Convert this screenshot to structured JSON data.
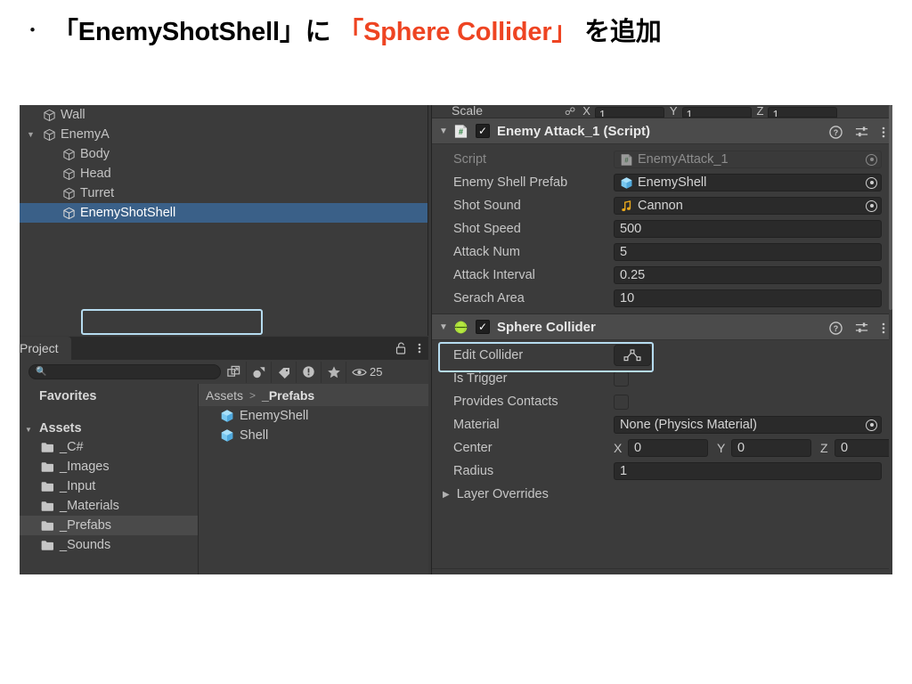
{
  "slide": {
    "bullet": "・",
    "title_main_1": "「EnemyShotShell」に ",
    "title_accent": "「Sphere Collider」",
    "title_main_2": " を追加",
    "accent_color": "#ee4422"
  },
  "hierarchy": {
    "items": [
      {
        "label": "Wall",
        "indent": 1,
        "expanded": null,
        "selected": false,
        "icon": "gameobject-cube-icon"
      },
      {
        "label": "EnemyA",
        "indent": 1,
        "expanded": true,
        "selected": false,
        "icon": "gameobject-cube-icon"
      },
      {
        "label": "Body",
        "indent": 2,
        "expanded": null,
        "selected": false,
        "icon": "gameobject-cube-icon"
      },
      {
        "label": "Head",
        "indent": 2,
        "expanded": null,
        "selected": false,
        "icon": "gameobject-cube-icon"
      },
      {
        "label": "Turret",
        "indent": 2,
        "expanded": null,
        "selected": false,
        "icon": "gameobject-cube-icon"
      },
      {
        "label": "EnemyShotShell",
        "indent": 2,
        "expanded": null,
        "selected": true,
        "icon": "gameobject-cube-icon"
      }
    ]
  },
  "project": {
    "tab_label": "Project",
    "lock_icon": "lock-icon",
    "menu_icon": "kebab-menu-icon",
    "search": {
      "value": "",
      "placeholder": ""
    },
    "toolbar_icons": [
      "open-in-new-window-icon",
      "filter-by-type-icon",
      "filter-by-label-icon",
      "warning-filter-icon",
      "favorite-star-icon"
    ],
    "visible_count": "25",
    "favorites_label": "Favorites",
    "assets_label": "Assets",
    "folders": [
      {
        "label": "_C#",
        "active": false
      },
      {
        "label": "_Images",
        "active": false
      },
      {
        "label": "_Input",
        "active": false
      },
      {
        "label": "_Materials",
        "active": false
      },
      {
        "label": "_Prefabs",
        "active": true
      },
      {
        "label": "_Sounds",
        "active": false
      }
    ],
    "breadcrumb": {
      "root": "Assets",
      "separator": ">",
      "current": "_Prefabs"
    },
    "assets": [
      {
        "label": "EnemyShell",
        "icon": "prefab-cube-icon"
      },
      {
        "label": "Shell",
        "icon": "prefab-cube-icon"
      }
    ]
  },
  "inspector": {
    "scale_row": {
      "label": "Scale",
      "link_icon": "constrain-proportions-icon",
      "x_axis": "X",
      "x_value": "1",
      "y_axis": "Y",
      "y_value": "1",
      "z_axis": "Z",
      "z_value": "1"
    },
    "components": [
      {
        "title": "Enemy Attack_1 (Script)",
        "icon": "csharp-script-icon",
        "enabled": true,
        "expanded": true,
        "highlighted": false,
        "header_icons": [
          "help-icon",
          "preset-icon",
          "kebab-menu-icon"
        ],
        "properties": [
          {
            "label": "Script",
            "type": "object",
            "value": "EnemyAttack_1",
            "icon": "csharp-script-icon",
            "disabled": true
          },
          {
            "label": "Enemy Shell Prefab",
            "type": "object",
            "value": "EnemyShell",
            "icon": "prefab-cube-icon",
            "disabled": false
          },
          {
            "label": "Shot Sound",
            "type": "object",
            "value": "Cannon",
            "icon": "audio-clip-icon",
            "disabled": false
          },
          {
            "label": "Shot Speed",
            "type": "text",
            "value": "500",
            "disabled": false
          },
          {
            "label": "Attack Num",
            "type": "text",
            "value": "5",
            "disabled": false
          },
          {
            "label": "Attack Interval",
            "type": "text",
            "value": "0.25",
            "disabled": false
          },
          {
            "label": "Serach Area",
            "type": "text",
            "value": "10",
            "disabled": false
          }
        ]
      },
      {
        "title": "Sphere Collider",
        "icon": "sphere-collider-icon",
        "enabled": true,
        "expanded": true,
        "highlighted": true,
        "header_icons": [
          "help-icon",
          "preset-icon",
          "kebab-menu-icon"
        ],
        "properties": [
          {
            "label": "Edit Collider",
            "type": "button",
            "value": "",
            "icon": "edit-collider-icon"
          },
          {
            "label": "Is Trigger",
            "type": "checkbox",
            "checked": false
          },
          {
            "label": "Provides Contacts",
            "type": "checkbox",
            "checked": false
          },
          {
            "label": "Material",
            "type": "object",
            "value": "None (Physics Material)",
            "disabled": false
          },
          {
            "label": "Center",
            "type": "vector3",
            "x_axis": "X",
            "x": "0",
            "y_axis": "Y",
            "y": "0",
            "z_axis": "Z",
            "z": "0"
          },
          {
            "label": "Radius",
            "type": "text",
            "value": "1"
          },
          {
            "label": "Layer Overrides",
            "type": "foldout",
            "expanded": false
          }
        ]
      }
    ]
  }
}
